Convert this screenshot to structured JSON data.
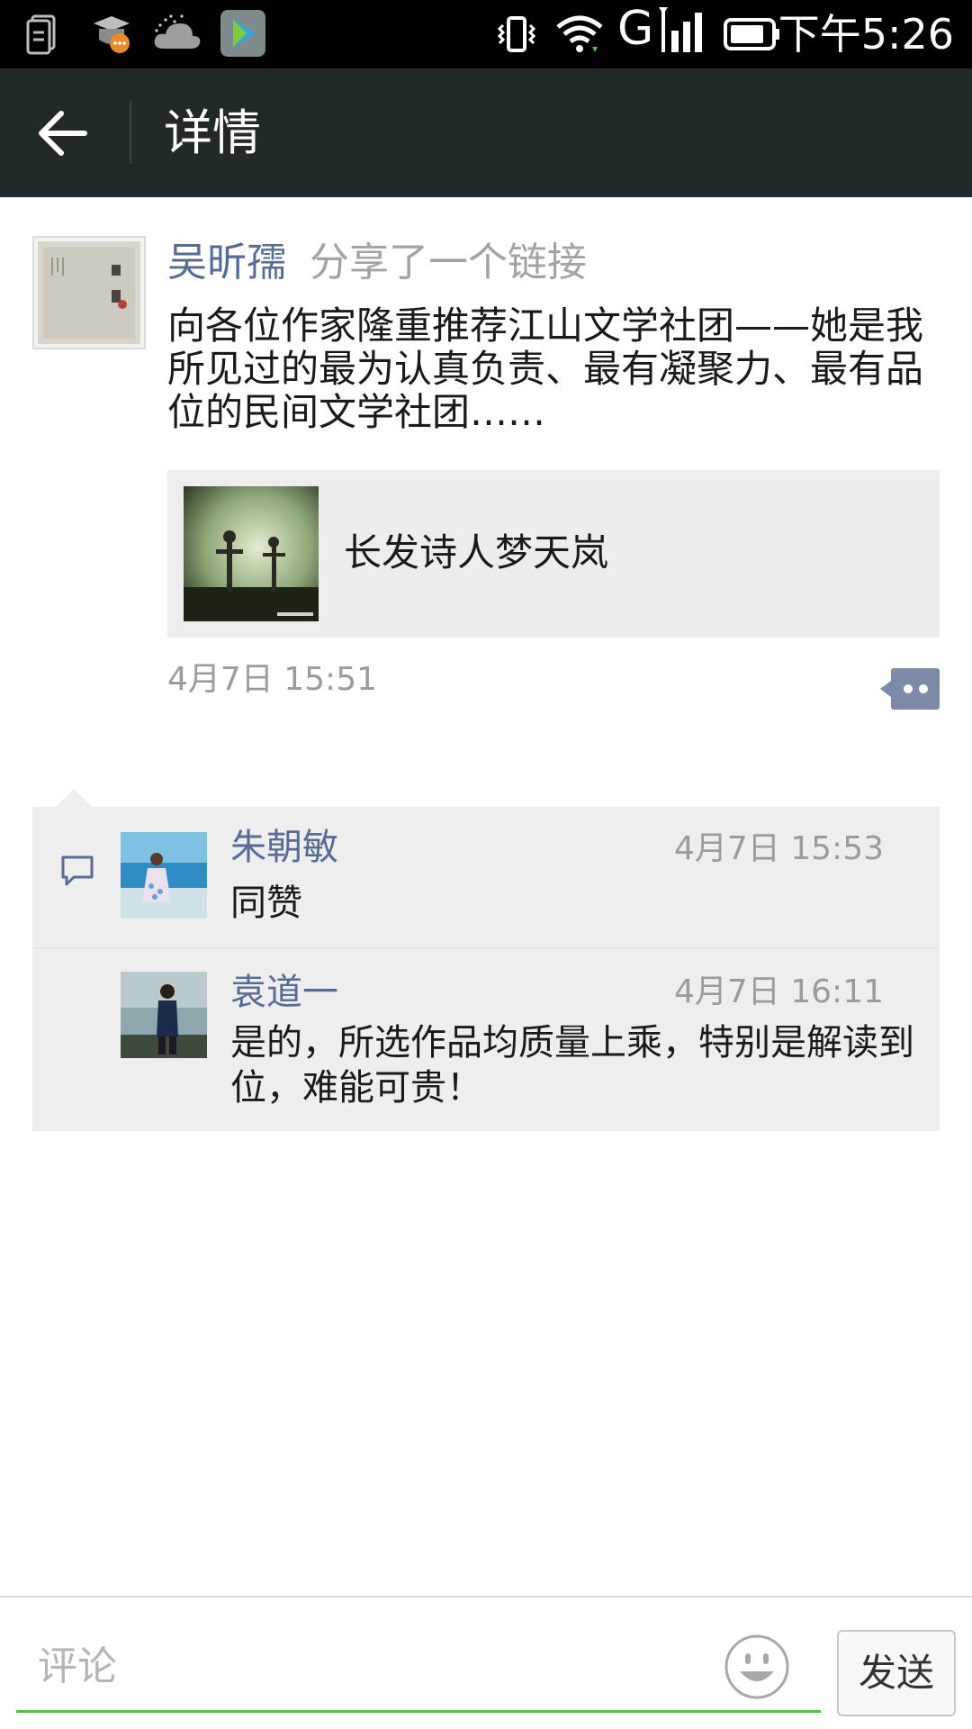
{
  "status_bar": {
    "time": "下午5:26",
    "network": "G",
    "icons": [
      "file-manager-icon",
      "chat-notification-icon",
      "weather-icon",
      "video-app-icon",
      "vibrate-icon",
      "wifi-icon",
      "signal-icon",
      "battery-icon"
    ]
  },
  "header": {
    "title": "详情",
    "back_icon": "back-arrow-icon"
  },
  "post": {
    "author": "吴昕孺",
    "action": "分享了一个链接",
    "text": "向各位作家隆重推荐江山文学社团——她是我所见过的最为认真负责、最有凝聚力、最有品位的民间文学社团……",
    "link": {
      "title": "长发诗人梦天岚"
    },
    "time": "4月7日 15:51"
  },
  "comments": [
    {
      "name": "朱朝敏",
      "time": "4月7日 15:53",
      "text": "同赞"
    },
    {
      "name": "袁道一",
      "time": "4月7日 16:11",
      "text": "是的，所选作品均质量上乘，特别是解读到位，难能可贵！"
    }
  ],
  "input": {
    "placeholder": "评论",
    "value": "",
    "send_label": "发送"
  },
  "colors": {
    "accent_link": "#576b95",
    "title_bar": "#22292d",
    "input_underline": "#4fc04a"
  }
}
